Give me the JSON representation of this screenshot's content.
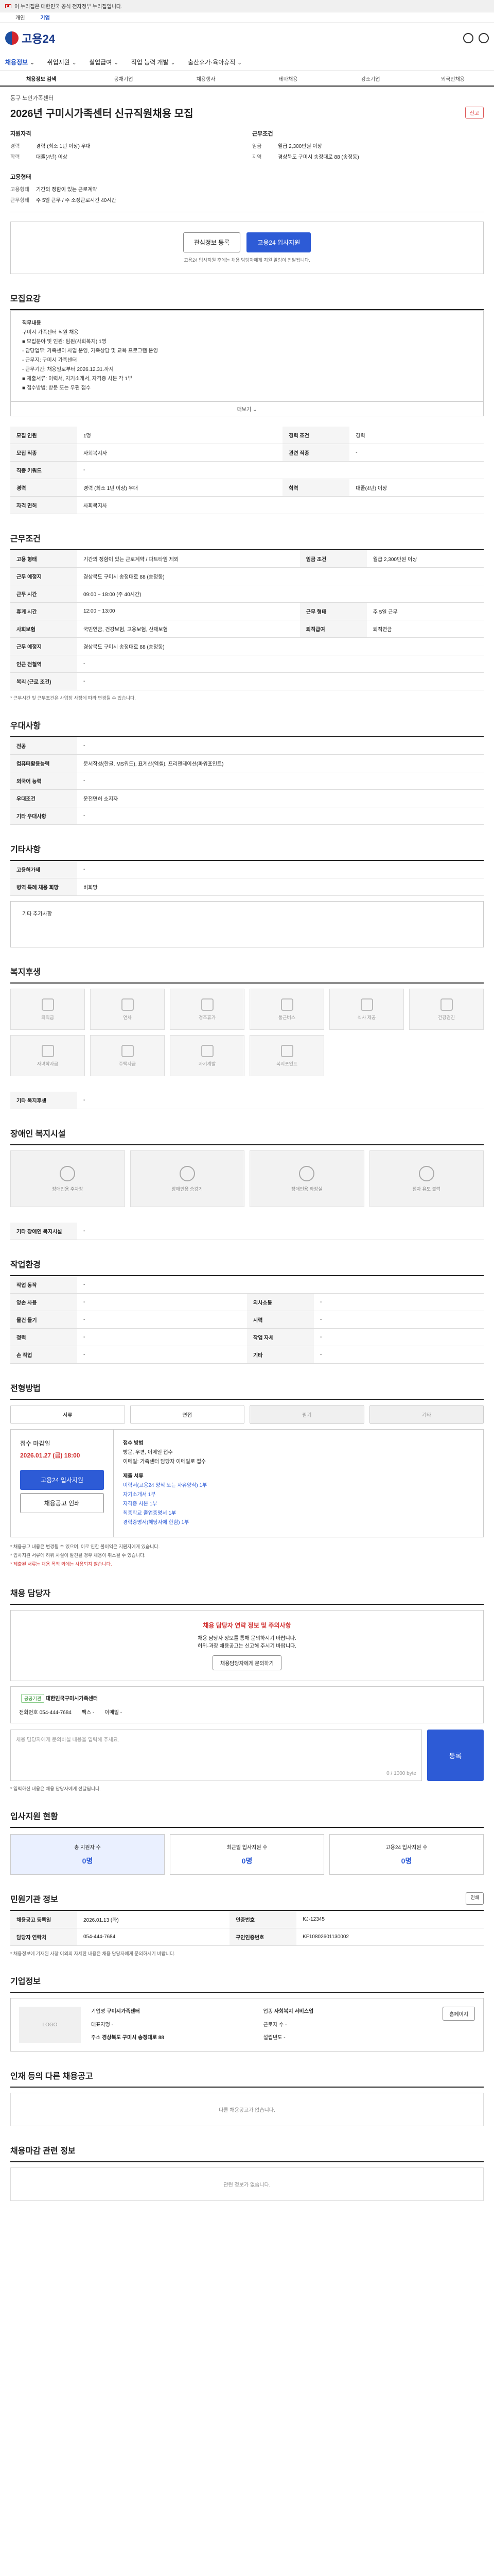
{
  "topbar": {
    "notice": "이 누리집은 대한민국 공식 전자정부 누리집입니다."
  },
  "subnav": {
    "items": [
      "개인",
      "기업"
    ],
    "active": "기업"
  },
  "brand": {
    "name": "고용24"
  },
  "gnb": {
    "items": [
      "채용정보",
      "취업지원",
      "실업급여",
      "직업 능력 개발",
      "출산휴가·육아휴직"
    ]
  },
  "lnb": {
    "items": [
      "채용정보 검색",
      "공채기업",
      "채용행사",
      "테마채용",
      "강소기업",
      "외국인채용"
    ]
  },
  "job": {
    "company": "동구 노인가족센터",
    "title": "2026년 구미시가족센터 신규직원채용 모집",
    "report_label": "신고",
    "summary_left_title": "지원자격",
    "summary_right_title": "근무조건",
    "left": [
      {
        "k": "경력",
        "v": "경력 (최소 1년 이상) 우대"
      },
      {
        "k": "학력",
        "v": "대졸(4년) 이상"
      }
    ],
    "right": [
      {
        "k": "임금",
        "v": "월급 2,300만원 이상"
      },
      {
        "k": "지역",
        "v": "경상북도 구미시 송정대로 88 (송정동)"
      }
    ],
    "type_title": "고용형태",
    "types": [
      {
        "k": "고용형태",
        "v": "기간의 정함이 있는 근로계약"
      },
      {
        "k": "근무형태",
        "v": "주 5일 근무 / 주 소정근로시간 40시간"
      }
    ]
  },
  "apply": {
    "scrap": "관심정보 등록",
    "apply": "고용24 입사지원",
    "note": "고용24 입사지원 후에는 채용 담당자에게 지원 알림이 전달됩니다."
  },
  "recruit": {
    "title": "모집요강",
    "heading": "직무내용",
    "lines": [
      "구미시 가족센터 직원 채용",
      "■ 모집분야 및 인원: 팀원(사회복지) 1명",
      "- 담당업무: 가족센터 사업 운영, 가족상담 및 교육 프로그램 운영",
      "- 근무지: 구미시 가족센터",
      "- 근무기간: 채용일로부터 2026.12.31.까지",
      "■ 제출서류: 이력서, 자기소개서, 자격증 사본 각 1부",
      "■ 접수방법: 방문 또는 우편 접수"
    ],
    "more": "더보기 ⌄",
    "rows": [
      {
        "k": "모집 인원",
        "v": "1명",
        "k2": "경력 조건",
        "v2": "경력"
      },
      {
        "k": "모집 직종",
        "v": "사회복지사",
        "k2": "관련 직종",
        "v2": "-"
      },
      {
        "k": "직종 키워드",
        "v": "-",
        "k2": "",
        "v2": ""
      },
      {
        "k": "경력",
        "v": "경력 (최소 1년 이상) 우대",
        "k2": "학력",
        "v2": "대졸(4년) 이상"
      },
      {
        "k": "자격 면허",
        "v": "사회복지사",
        "k2": "",
        "v2": ""
      }
    ]
  },
  "cond": {
    "title": "근무조건",
    "rows": [
      {
        "k": "고용 형태",
        "v": "기간의 정함이 있는 근로계약 / 파트타임 제외",
        "k2": "임금 조건",
        "v2": "월급 2,300만원 이상"
      },
      {
        "k": "근무 예정지",
        "v": "경상북도 구미시 송정대로 88 (송정동)",
        "k2": "",
        "v2": ""
      },
      {
        "k": "근무 시간",
        "v": "09:00 ~ 18:00 (주 40시간)",
        "k2": "",
        "v2": ""
      },
      {
        "k": "휴게 시간",
        "v": "12:00 ~ 13:00",
        "k2": "근무 형태",
        "v2": "주 5일 근무"
      },
      {
        "k": "사회보험",
        "v": "국민연금, 건강보험, 고용보험, 산재보험",
        "k2": "퇴직급여",
        "v2": "퇴직연금"
      },
      {
        "k": "근무 예정지",
        "v": "경상북도 구미시 송정대로 88 (송정동)",
        "k2": "",
        "v2": ""
      },
      {
        "k": "인근 전철역",
        "v": "-",
        "k2": "",
        "v2": ""
      },
      {
        "k": "복리 (근로 조건)",
        "v": "-",
        "k2": "",
        "v2": ""
      }
    ],
    "note": "* 근무시간 및 근무조건은 사업장 사정에 따라 변경될 수 있습니다."
  },
  "prefer": {
    "title": "우대사항",
    "rows": [
      {
        "k": "전공",
        "v": "-"
      },
      {
        "k": "컴퓨터활용능력",
        "v": "문서작성(한글, MS워드), 표계산(엑셀), 프리젠테이션(파워포인트)"
      },
      {
        "k": "외국어 능력",
        "v": "-"
      },
      {
        "k": "우대조건",
        "v": "운전면허 소지자"
      },
      {
        "k": "기타 우대사항",
        "v": "-"
      }
    ]
  },
  "etc": {
    "title": "기타사항",
    "rows": [
      {
        "k": "고용허가제",
        "v": "-"
      },
      {
        "k": "병역 특례 채용 희망",
        "v": "비희망"
      }
    ],
    "extra_label": "기타 추가사항"
  },
  "welfare": {
    "title": "복지후생",
    "items": [
      "퇴직금",
      "연차",
      "경조휴가",
      "통근버스",
      "식사 제공",
      "건강검진",
      "자녀학자금",
      "주택자금",
      "자기계발",
      "복지포인트",
      "유연근무",
      "동호회"
    ],
    "other_label": "기타 복지후생"
  },
  "disability": {
    "title": "장애인 복지시설",
    "items": [
      "장애인용 주차장",
      "장애인용 승강기",
      "장애인용 화장실",
      "점자 유도 블럭"
    ],
    "other_label": "기타 장애인 복지시설"
  },
  "env": {
    "title": "작업환경",
    "rows": [
      {
        "k": "작업 동작",
        "v": "-",
        "k2": "",
        "v2": ""
      },
      {
        "k": "양손 사용",
        "v": "-",
        "k2": "의사소통",
        "v2": "-"
      },
      {
        "k": "물건 들기",
        "v": "-",
        "k2": "시력",
        "v2": "-"
      },
      {
        "k": "청력",
        "v": "-",
        "k2": "작업 자세",
        "v2": "-"
      },
      {
        "k": "손 작업",
        "v": "-",
        "k2": "기타",
        "v2": "-"
      }
    ]
  },
  "process": {
    "title": "전형방법",
    "methods": [
      {
        "label": "서류",
        "on": true
      },
      {
        "label": "면접",
        "on": true
      },
      {
        "label": "필기",
        "on": false
      },
      {
        "label": "기타",
        "on": false
      }
    ],
    "period_label": "접수 마감일",
    "period_date": "2026.01.27 (금) 18:00",
    "apply_btn": "고용24 입사지원",
    "print_btn": "채용공고 인쇄",
    "doc_title": "접수 방법",
    "docs_head": "제출 서류",
    "method_lines": [
      "방문, 우편, 이메일 접수",
      "이메일: 가족센터 담당자 이메일로 접수"
    ],
    "doc_lines": [
      "이력서(고용24 양식 또는 자유양식) 1부",
      "자기소개서 1부",
      "자격증 사본 1부",
      "최종학교 졸업증명서 1부",
      "경력증명서(해당자에 한함) 1부"
    ],
    "warn": [
      "* 채용공고 내용은 변경될 수 있으며, 이로 인한 불이익은 지원자에게 있습니다.",
      "* 입사지원 서류에 허위 사실이 발견될 경우 채용이 취소될 수 있습니다.",
      "* 제출된 서류는 채용 목적 외에는 사용되지 않습니다."
    ]
  },
  "contact": {
    "title": "채용 담당자",
    "alert": "채용 담당자 연락 정보 및 주의사항",
    "line1": "채용 담당자 정보를 통해 문의하시기 바랍니다.",
    "line2": "허위·과장 채용공고는 신고해 주시기 바랍니다.",
    "btn": "채용담당자에게 문의하기",
    "agency_tag": "공공기관",
    "agency_name": "대한민국구미시가족센터",
    "phone_label": "전화번호",
    "phone": "054-444-7684",
    "fax_label": "팩스",
    "fax": "-",
    "email_label": "이메일",
    "email": "-",
    "q_placeholder": "채용 담당자에게 문의하실 내용을 입력해 주세요.",
    "q_count": "0 / 1000 byte",
    "q_send": "등록",
    "q_note": "* 입력하신 내용은 채용 담당자에게 전달됩니다."
  },
  "stats": {
    "title": "입사지원 현황",
    "items": [
      {
        "label": "총 지원자 수",
        "value": "0명"
      },
      {
        "label": "최근일 입사지원 수",
        "value": "0명"
      },
      {
        "label": "고용24 입사지원 수",
        "value": "0명"
      }
    ]
  },
  "sysinfo": {
    "title": "민원기관 정보",
    "print": "인쇄",
    "rows": [
      {
        "k": "채용공고 등록일",
        "v": "2026.01.13 (화)",
        "k2": "인증번호",
        "v2": "KJ-12345"
      },
      {
        "k": "담당자 연락처",
        "v": "054-444-7684",
        "k2": "구인인증번호",
        "v2": "KF10802601130002"
      }
    ],
    "note": "* 채용정보에 기재된 사항 이외의 자세한 내용은 채용 담당자에게 문의하시기 바랍니다."
  },
  "corp": {
    "title": "기업정보",
    "logo_alt": "LOGO",
    "fields": [
      {
        "k": "기업명",
        "v": "구미시가족센터"
      },
      {
        "k": "업종",
        "v": "사회복지 서비스업"
      },
      {
        "k": "대표자명",
        "v": "-"
      },
      {
        "k": "근로자 수",
        "v": "-"
      },
      {
        "k": "주소",
        "v": "경상북도 구미시 송정대로 88"
      },
      {
        "k": "설립년도",
        "v": "-"
      }
    ],
    "home_btn": "홈페이지"
  },
  "others": {
    "title": "인재 등의 다른 채용공고",
    "empty": "다른 채용공고가 없습니다."
  },
  "related": {
    "title": "채용마감 관련 정보",
    "empty": "관련 정보가 없습니다."
  }
}
